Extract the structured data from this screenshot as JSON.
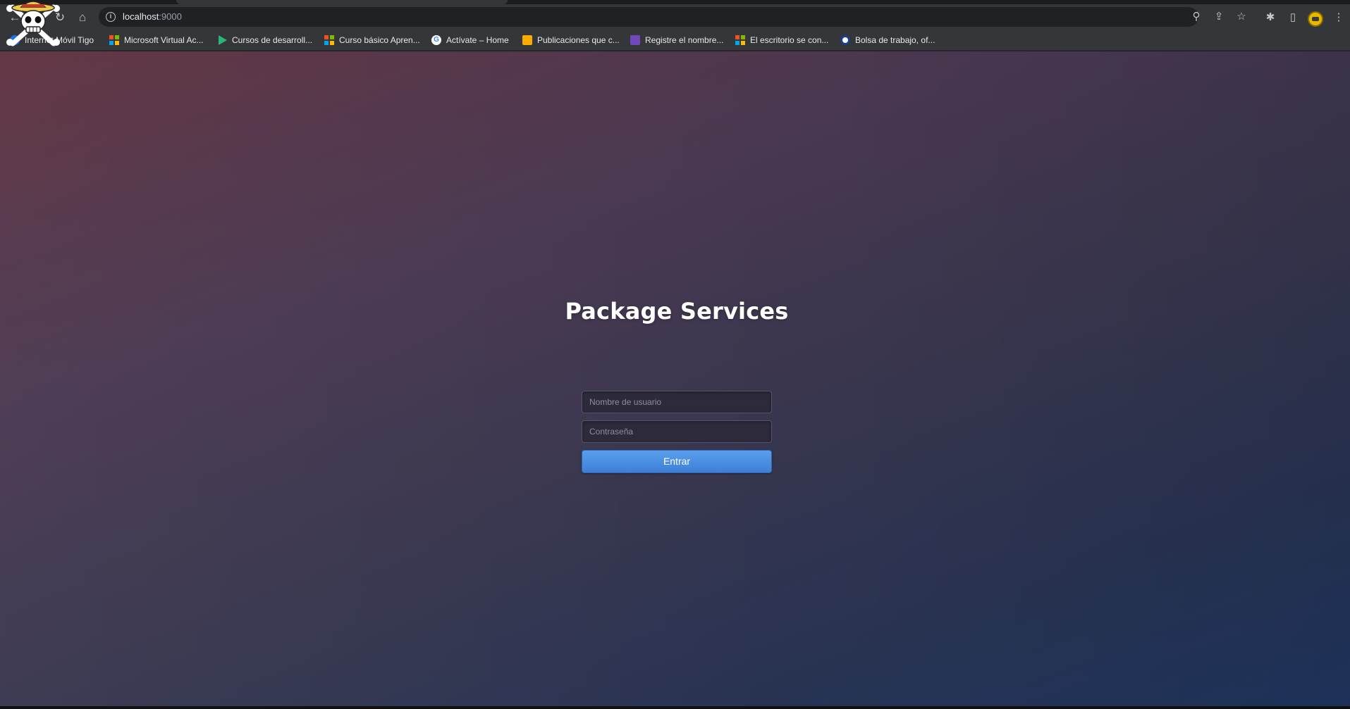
{
  "browser": {
    "url_host": "localhost",
    "url_port": ":9000",
    "bookmarks": [
      {
        "label": "Internet Móvil Tigo",
        "icon": "tigo-icon"
      },
      {
        "label": "Microsoft Virtual Ac...",
        "icon": "microsoft-icon"
      },
      {
        "label": "Cursos de desarroll...",
        "icon": "play-icon"
      },
      {
        "label": "Curso básico Apren...",
        "icon": "microsoft-icon"
      },
      {
        "label": "Actívate – Home",
        "icon": "google-icon"
      },
      {
        "label": "Publicaciones que c...",
        "icon": "publication-icon"
      },
      {
        "label": "Registre el nombre...",
        "icon": "form-icon"
      },
      {
        "label": "El escritorio se con...",
        "icon": "microsoft-icon"
      },
      {
        "label": "Bolsa de trabajo, of...",
        "icon": "bolsa-icon"
      }
    ]
  },
  "login": {
    "title": "Package Services",
    "username_placeholder": "Nombre de usuario",
    "password_placeholder": "Contraseña",
    "submit_label": "Entrar"
  },
  "colors": {
    "button": "#4a8fe3",
    "background_left": "#5f3140",
    "background_right": "#1f3560"
  }
}
